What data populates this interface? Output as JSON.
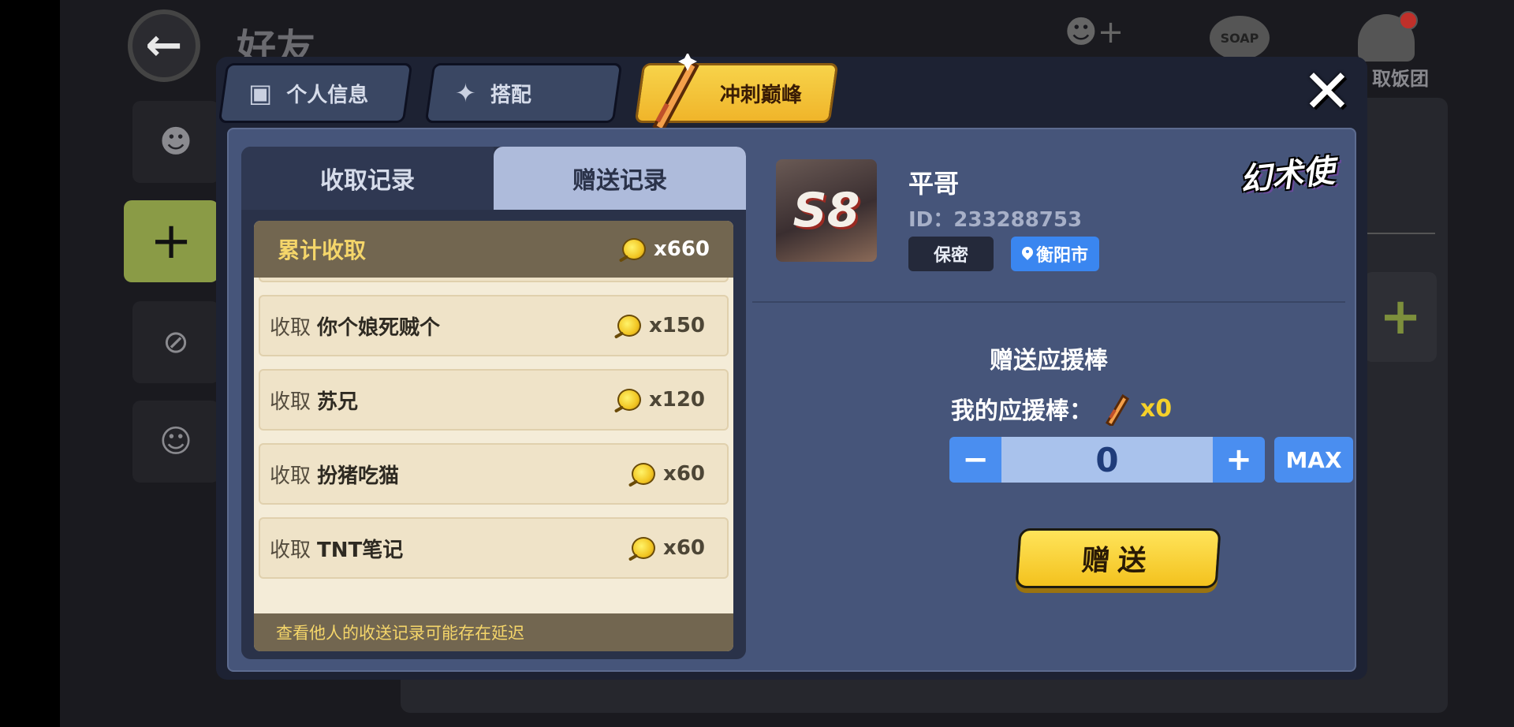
{
  "background": {
    "page_title": "好友",
    "top_right_label": "取饭团",
    "soap_icon_text": "SOAP"
  },
  "modal": {
    "tabs": [
      {
        "label": "个人信息",
        "icon": "id-card-icon"
      },
      {
        "label": "搭配",
        "icon": "star-icon"
      },
      {
        "label": "冲刺巅峰",
        "icon": "cheer-stick-icon",
        "active": true
      }
    ],
    "records": {
      "tabs": [
        {
          "label": "收取记录",
          "active": true
        },
        {
          "label": "赠送记录",
          "active": false
        }
      ],
      "summary": {
        "label": "累计收取",
        "amount": "x660"
      },
      "rows": [
        {
          "prefix": "收取",
          "name": "你个娘死贼个",
          "amount": "x150"
        },
        {
          "prefix": "收取",
          "name": "苏兄",
          "amount": "x120"
        },
        {
          "prefix": "收取",
          "name": "扮猪吃猫",
          "amount": "x60"
        },
        {
          "prefix": "收取",
          "name": "TNT笔记",
          "amount": "x60"
        }
      ],
      "footer_note": "查看他人的收送记录可能存在延迟"
    },
    "profile": {
      "avatar_text": "S8",
      "name": "平哥",
      "id_text": "ID：233288753",
      "privacy_tag": "保密",
      "city_tag": "衡阳市",
      "title_badge": "幻术使"
    },
    "gift": {
      "title": "赠送应援棒",
      "my_label": "我的应援棒：",
      "my_count": "x0",
      "minus": "−",
      "value": "0",
      "plus": "+",
      "max": "MAX",
      "send": "赠送"
    }
  },
  "colors": {
    "accent_blue": "#4a8ef0",
    "gold": "#f5d02a",
    "panel": "#46557a"
  }
}
